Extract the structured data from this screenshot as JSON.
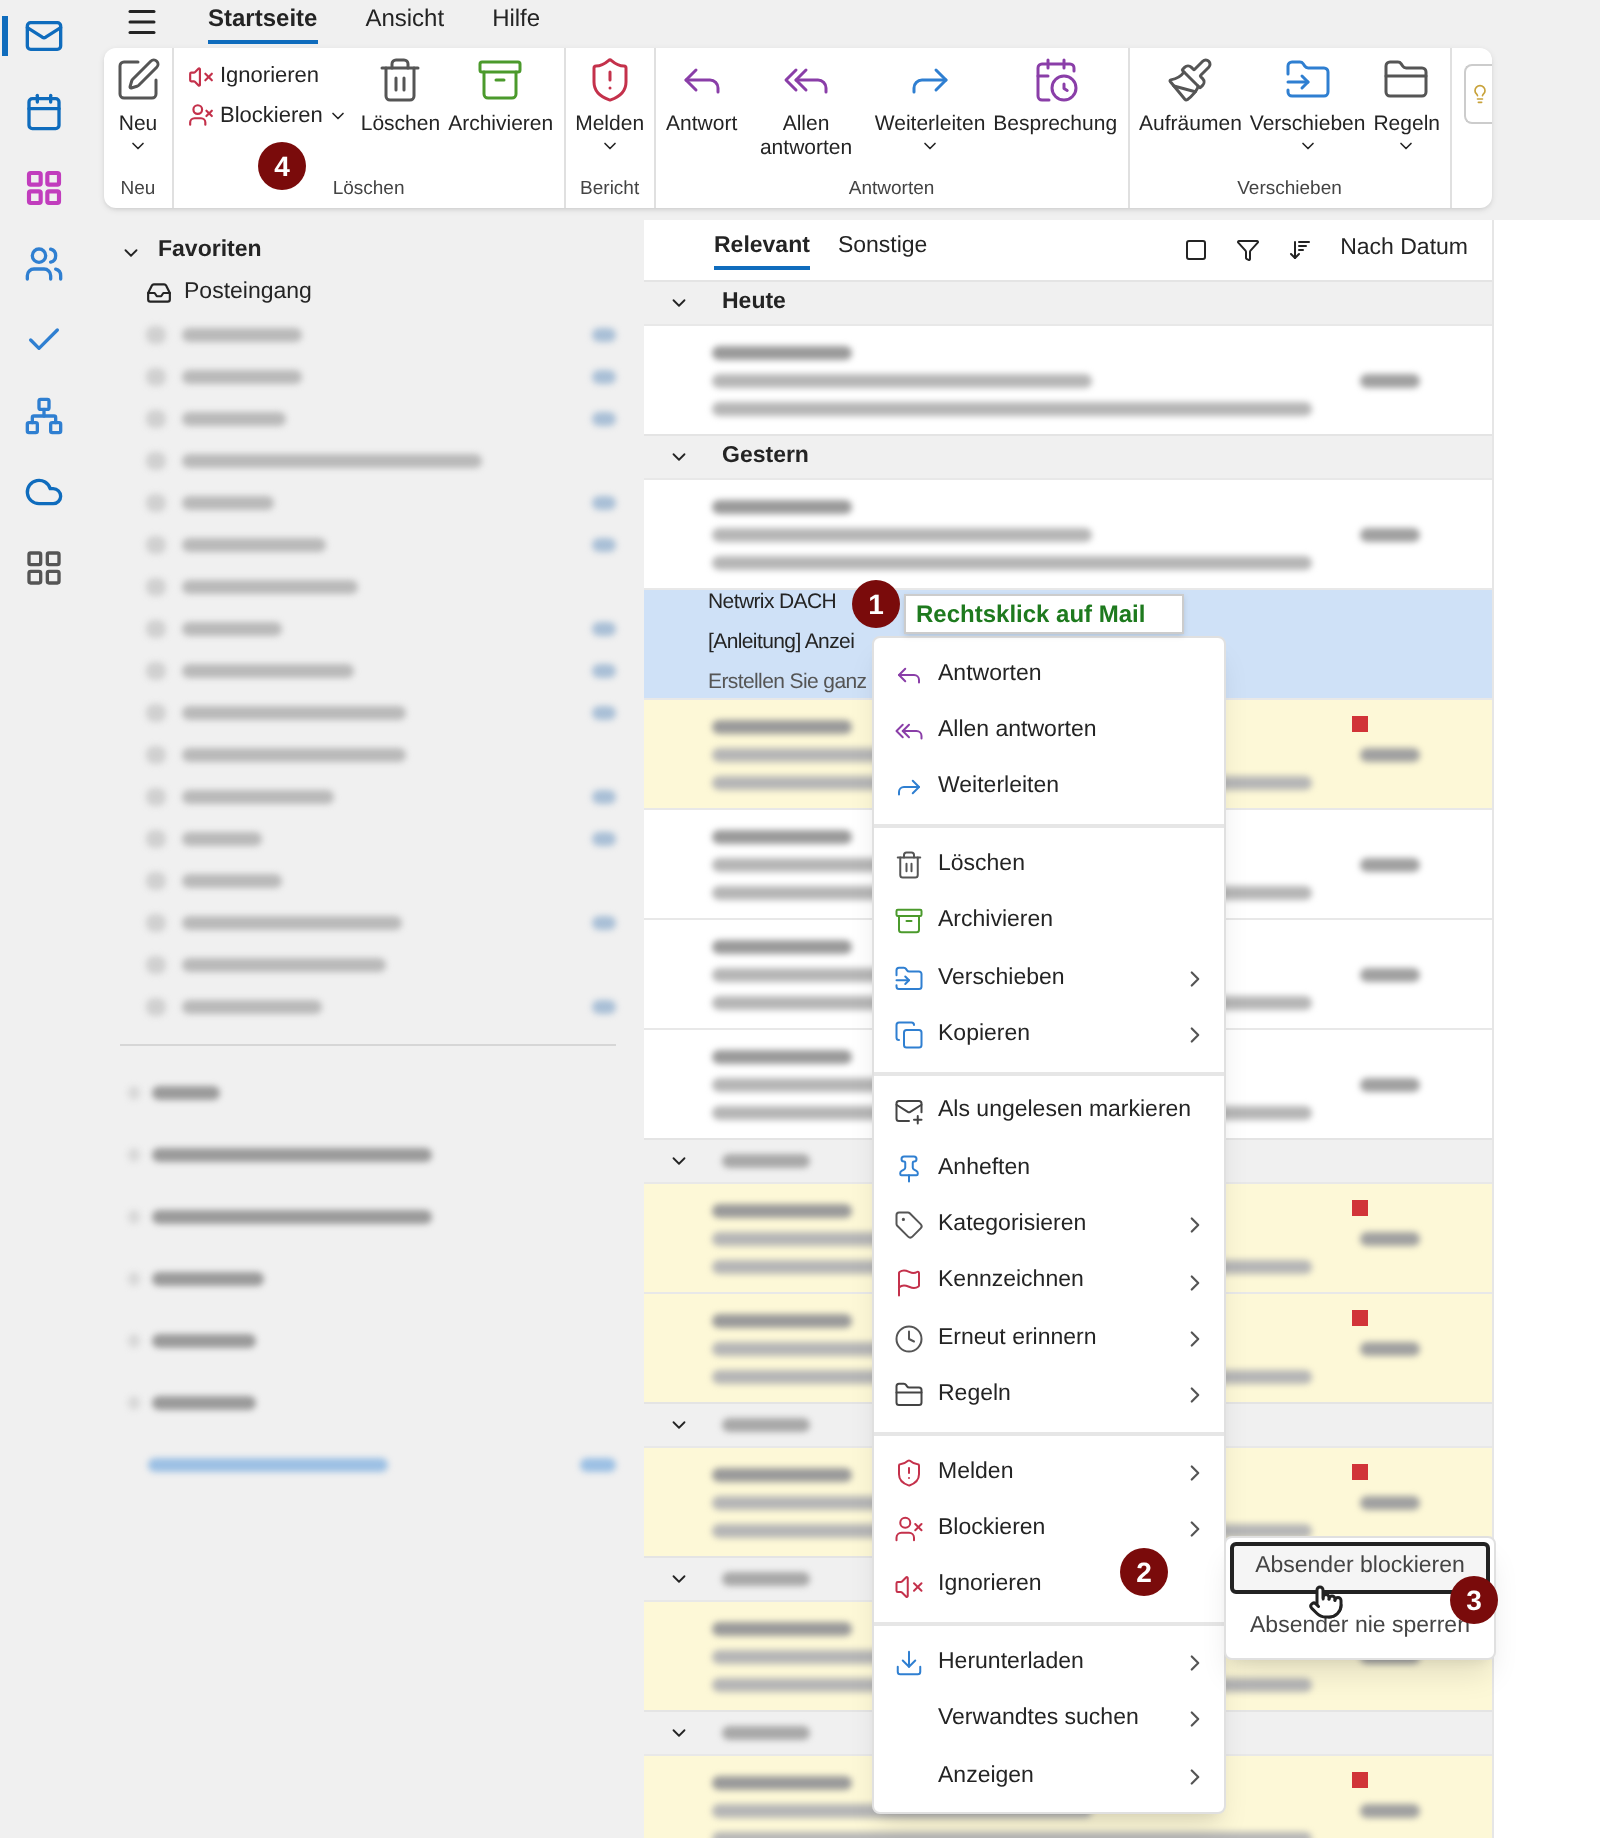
{
  "top_tabs": [
    {
      "label": "Startseite",
      "selected": true
    },
    {
      "label": "Ansicht",
      "selected": false
    },
    {
      "label": "Hilfe",
      "selected": false
    }
  ],
  "ribbon": [
    {
      "group": "Neu",
      "buttons": [
        {
          "kind": "large",
          "label": "Neu",
          "dropdown": true
        }
      ]
    },
    {
      "group": "Löschen",
      "buttons": [
        {
          "kind": "small",
          "label": "Ignorieren",
          "dropdown": false
        },
        {
          "kind": "small",
          "label": "Blockieren",
          "dropdown": true
        },
        {
          "kind": "large",
          "label": "Löschen",
          "dropdown": false
        },
        {
          "kind": "large",
          "label": "Archivieren",
          "dropdown": false
        }
      ]
    },
    {
      "group": "Bericht",
      "buttons": [
        {
          "kind": "large",
          "label": "Melden",
          "dropdown": true
        }
      ]
    },
    {
      "group": "Antworten",
      "buttons": [
        {
          "kind": "large",
          "label": "Antwort",
          "dropdown": false
        },
        {
          "kind": "large",
          "label": "Allen antworten",
          "dropdown": false
        },
        {
          "kind": "large",
          "label": "Weiterleiten",
          "dropdown": true
        },
        {
          "kind": "large",
          "label": "Besprechung",
          "dropdown": false
        }
      ]
    },
    {
      "group": "Verschieben",
      "buttons": [
        {
          "kind": "large",
          "label": "Aufräumen",
          "dropdown": false
        },
        {
          "kind": "large",
          "label": "Verschieben",
          "dropdown": true
        },
        {
          "kind": "large",
          "label": "Regeln",
          "dropdown": true
        }
      ]
    }
  ],
  "folders": {
    "title": "Favoriten",
    "expanded": true,
    "items": [
      {
        "kind": "folder",
        "label": "Posteingang"
      },
      {
        "kind": "blurred",
        "count": true
      },
      {
        "kind": "blurred",
        "count": true
      },
      {
        "kind": "blurred",
        "count": true
      },
      {
        "kind": "blurred",
        "count": false
      },
      {
        "kind": "blurred",
        "count": true
      },
      {
        "kind": "blurred",
        "count": true
      },
      {
        "kind": "blurred",
        "count": false
      },
      {
        "kind": "blurred",
        "count": true
      },
      {
        "kind": "blurred",
        "count": true
      },
      {
        "kind": "blurred",
        "count": true
      },
      {
        "kind": "blurred",
        "count": false
      },
      {
        "kind": "blurred",
        "count": true
      },
      {
        "kind": "blurred",
        "count": true
      },
      {
        "kind": "blurred",
        "count": false
      },
      {
        "kind": "blurred",
        "count": true
      },
      {
        "kind": "blurred",
        "count": false
      },
      {
        "kind": "blurred",
        "count": true
      }
    ],
    "accounts": [
      {
        "kind": "blurred"
      },
      {
        "kind": "blurred"
      },
      {
        "kind": "blurred"
      },
      {
        "kind": "blurred"
      },
      {
        "kind": "blurred"
      },
      {
        "kind": "blurred"
      },
      {
        "kind": "link"
      }
    ]
  },
  "list_tabs": [
    {
      "label": "Relevant",
      "selected": true
    },
    {
      "label": "Sonstige",
      "selected": false
    }
  ],
  "sort_label": "Nach Datum",
  "groups": [
    {
      "title": "Heute",
      "rows": [
        {
          "kind": "blurred",
          "selected": false,
          "highlighted": false,
          "flagged": false
        }
      ]
    },
    {
      "title": "Gestern",
      "rows": [
        {
          "kind": "blurred",
          "selected": false,
          "highlighted": false,
          "flagged": false
        },
        {
          "kind": "mail",
          "sender": "Netwrix DACH",
          "subject": "[Anleitung] Anzei",
          "preview": "Erstellen Sie ganz",
          "selected": true,
          "highlighted": false,
          "flagged": false
        },
        {
          "kind": "blurred",
          "selected": false,
          "highlighted": true,
          "flagged": true
        },
        {
          "kind": "blurred",
          "selected": false,
          "highlighted": false,
          "flagged": false
        },
        {
          "kind": "blurred",
          "selected": false,
          "highlighted": false,
          "flagged": false
        },
        {
          "kind": "blurred",
          "selected": false,
          "highlighted": false,
          "flagged": false
        }
      ]
    },
    {
      "rows": [
        {
          "kind": "blurred",
          "selected": false,
          "highlighted": true,
          "flagged": true
        },
        {
          "kind": "blurred",
          "selected": false,
          "highlighted": true,
          "flagged": true
        }
      ]
    },
    {
      "rows": [
        {
          "kind": "blurred",
          "selected": false,
          "highlighted": true,
          "flagged": true
        }
      ]
    },
    {
      "rows": [
        {
          "kind": "blurred",
          "selected": false,
          "highlighted": true,
          "flagged": false
        }
      ]
    },
    {
      "rows": [
        {
          "kind": "blurred",
          "selected": false,
          "highlighted": true,
          "flagged": true
        }
      ]
    }
  ],
  "context_menu": [
    {
      "label": "Antworten",
      "submenu": false,
      "divider_before": false
    },
    {
      "label": "Allen antworten",
      "submenu": false,
      "divider_before": false
    },
    {
      "label": "Weiterleiten",
      "submenu": false,
      "divider_before": false
    },
    {
      "label": "Löschen",
      "submenu": false,
      "divider_before": true
    },
    {
      "label": "Archivieren",
      "submenu": false,
      "divider_before": false
    },
    {
      "label": "Verschieben",
      "submenu": true,
      "divider_before": false
    },
    {
      "label": "Kopieren",
      "submenu": true,
      "divider_before": false
    },
    {
      "label": "Als ungelesen markieren",
      "submenu": false,
      "divider_before": true
    },
    {
      "label": "Anheften",
      "submenu": false,
      "divider_before": false
    },
    {
      "label": "Kategorisieren",
      "submenu": true,
      "divider_before": false
    },
    {
      "label": "Kennzeichnen",
      "submenu": true,
      "divider_before": false
    },
    {
      "label": "Erneut erinnern",
      "submenu": true,
      "divider_before": false
    },
    {
      "label": "Regeln",
      "submenu": true,
      "divider_before": false
    },
    {
      "label": "Melden",
      "submenu": true,
      "divider_before": true
    },
    {
      "label": "Blockieren",
      "submenu": true,
      "divider_before": false
    },
    {
      "label": "Ignorieren",
      "submenu": false,
      "divider_before": false
    },
    {
      "label": "Herunterladen",
      "submenu": true,
      "divider_before": true
    },
    {
      "label": "Verwandtes suchen",
      "submenu": true,
      "divider_before": false
    },
    {
      "label": "Anzeigen",
      "submenu": true,
      "divider_before": false
    }
  ],
  "submenu": [
    {
      "label": "Absender blockieren",
      "selected": true
    },
    {
      "label": "Absender nie sperren",
      "selected": false
    }
  ],
  "callout": "Rechtsklick auf Mail",
  "step_badges": [
    "1",
    "2",
    "3",
    "4"
  ]
}
